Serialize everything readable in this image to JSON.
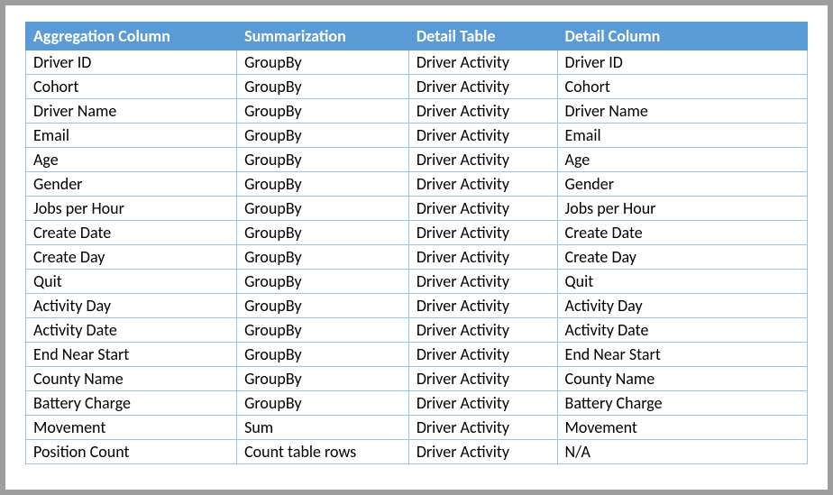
{
  "table": {
    "headers": {
      "aggregation_column": "Aggregation Column",
      "summarization": "Summarization",
      "detail_table": "Detail Table",
      "detail_column": "Detail Column"
    },
    "rows": [
      {
        "agg": "Driver ID",
        "sum": "GroupBy",
        "dt": "Driver Activity",
        "dc": "Driver ID"
      },
      {
        "agg": "Cohort",
        "sum": "GroupBy",
        "dt": "Driver Activity",
        "dc": "Cohort"
      },
      {
        "agg": "Driver Name",
        "sum": "GroupBy",
        "dt": "Driver Activity",
        "dc": "Driver Name"
      },
      {
        "agg": "Email",
        "sum": "GroupBy",
        "dt": "Driver Activity",
        "dc": "Email"
      },
      {
        "agg": "Age",
        "sum": "GroupBy",
        "dt": "Driver Activity",
        "dc": "Age"
      },
      {
        "agg": "Gender",
        "sum": "GroupBy",
        "dt": "Driver Activity",
        "dc": "Gender"
      },
      {
        "agg": "Jobs per Hour",
        "sum": "GroupBy",
        "dt": "Driver Activity",
        "dc": "Jobs per Hour"
      },
      {
        "agg": "Create Date",
        "sum": "GroupBy",
        "dt": "Driver Activity",
        "dc": "Create Date"
      },
      {
        "agg": "Create Day",
        "sum": "GroupBy",
        "dt": "Driver Activity",
        "dc": "Create Day"
      },
      {
        "agg": "Quit",
        "sum": "GroupBy",
        "dt": "Driver Activity",
        "dc": "Quit"
      },
      {
        "agg": "Activity Day",
        "sum": "GroupBy",
        "dt": "Driver Activity",
        "dc": "Activity Day"
      },
      {
        "agg": "Activity Date",
        "sum": "GroupBy",
        "dt": "Driver Activity",
        "dc": "Activity Date"
      },
      {
        "agg": "End Near Start",
        "sum": "GroupBy",
        "dt": "Driver Activity",
        "dc": "End Near Start"
      },
      {
        "agg": "County Name",
        "sum": "GroupBy",
        "dt": "Driver Activity",
        "dc": "County Name"
      },
      {
        "agg": "Battery Charge",
        "sum": "GroupBy",
        "dt": "Driver Activity",
        "dc": "Battery Charge"
      },
      {
        "agg": "Movement",
        "sum": "Sum",
        "dt": "Driver Activity",
        "dc": "Movement"
      },
      {
        "agg": "Position Count",
        "sum": "Count table rows",
        "dt": "Driver Activity",
        "dc": "N/A"
      }
    ]
  }
}
